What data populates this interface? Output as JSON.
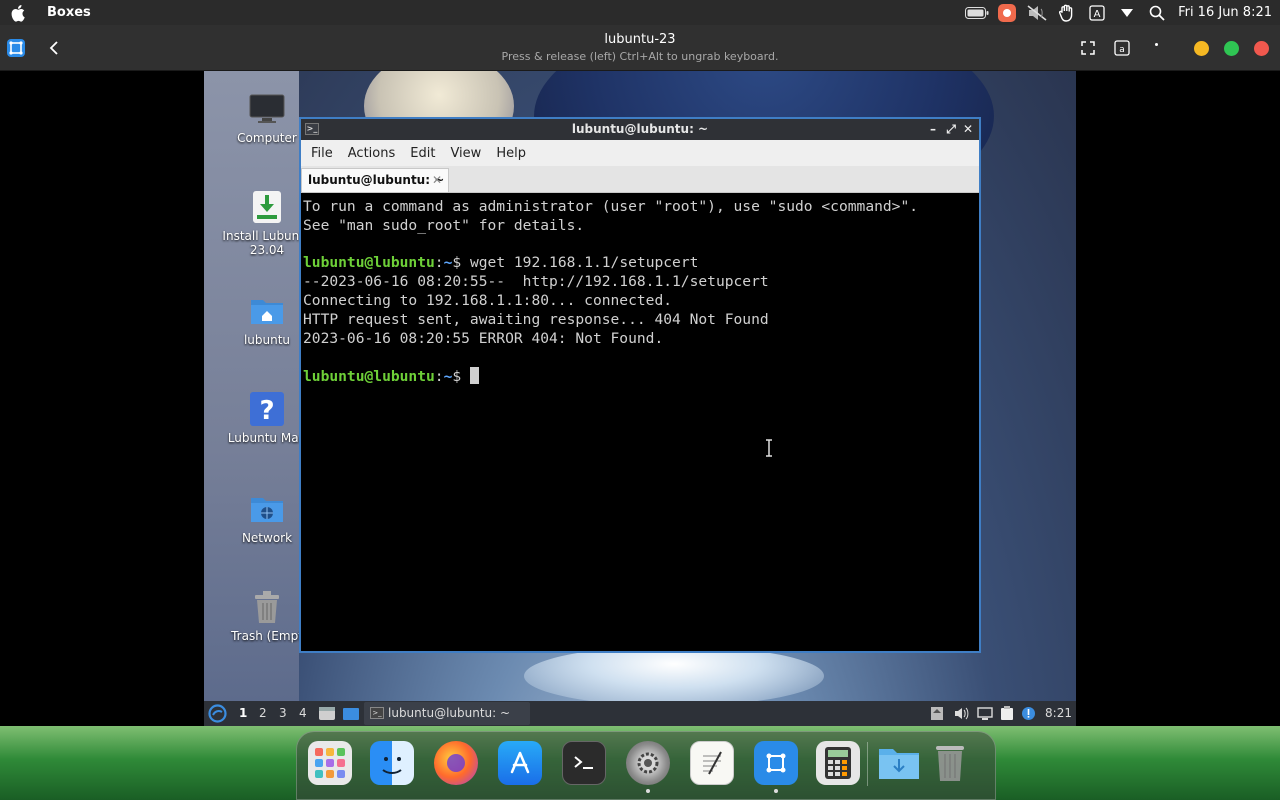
{
  "menubar": {
    "app_name": "Boxes",
    "clock": "Fri 16 Jun 8:21",
    "icons": [
      "apple-icon",
      "battery-icon",
      "app-tray-icon",
      "muted-icon",
      "hand-icon",
      "text-input-icon",
      "dropdown-icon",
      "search-icon"
    ]
  },
  "boxes": {
    "title": "lubuntu-23",
    "subtitle": "Press & release (left) Ctrl+Alt to ungrab keyboard."
  },
  "desktop": {
    "icons": [
      {
        "label": "Computer"
      },
      {
        "label": "Install Lubuntu",
        "label2": "23.04"
      },
      {
        "label": "lubuntu"
      },
      {
        "label": "Lubuntu Man"
      },
      {
        "label": "Network"
      },
      {
        "label": "Trash (Empt"
      }
    ]
  },
  "terminal": {
    "title": "lubuntu@lubuntu: ~",
    "menu": [
      "File",
      "Actions",
      "Edit",
      "View",
      "Help"
    ],
    "tab_label": "lubuntu@lubuntu: ~",
    "user_host": "lubuntu@lubuntu",
    "path_sep": ":",
    "path": "~",
    "dollar": "$ ",
    "lines": {
      "l1": "To run a command as administrator (user \"root\"), use \"sudo <command>\".",
      "l2": "See \"man sudo_root\" for details.",
      "cmd1": "wget 192.168.1.1/setupcert",
      "o1": "--2023-06-16 08:20:55--  http://192.168.1.1/setupcert",
      "o2": "Connecting to 192.168.1.1:80... connected.",
      "o3": "HTTP request sent, awaiting response... 404 Not Found",
      "o4": "2023-06-16 08:20:55 ERROR 404: Not Found."
    }
  },
  "vm_taskbar": {
    "workspaces": [
      "1",
      "2",
      "3",
      "4"
    ],
    "task_label": "lubuntu@lubuntu: ~",
    "clock": "8:21"
  },
  "dock": {
    "apps": [
      "launchpad",
      "finder",
      "firefox",
      "app-store",
      "terminal",
      "system-preferences",
      "textedit",
      "boxes",
      "calculator",
      "downloads",
      "trash"
    ]
  },
  "colors": {
    "prompt_user": "#6ed038",
    "prompt_path": "#5fa8ff",
    "window_border": "#3f7ec5"
  }
}
